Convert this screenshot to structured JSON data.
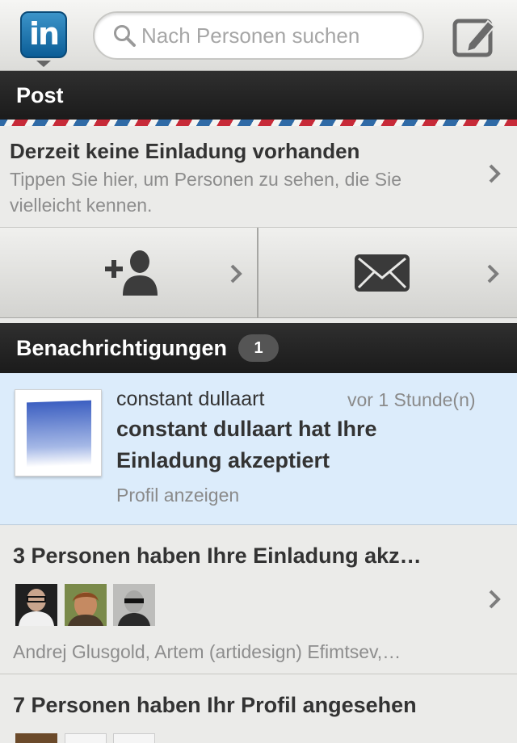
{
  "topbar": {
    "logo_text": "in",
    "search_placeholder": "Nach Personen suchen"
  },
  "inbox": {
    "header": "Post",
    "no_invites_title": "Derzeit keine Einladung vorhanden",
    "no_invites_sub_line1": "Tippen Sie hier, um Personen zu sehen, die Sie",
    "no_invites_sub_line2": "vielleicht kennen."
  },
  "notifications": {
    "header": "Benachrichtigungen",
    "count": "1",
    "items": [
      {
        "name": "constant dullaart",
        "time": "vor 1 Stunde(n)",
        "message_line1": "constant dullaart hat Ihre",
        "message_line2": "Einladung akzeptiert",
        "action": "Profil anzeigen"
      },
      {
        "title": "3 Personen haben Ihre Einladung akz…",
        "names": "Andrej Glusgold, Artem (artidesign) Efimtsev,…"
      },
      {
        "title": "7 Personen haben Ihr Profil angesehen"
      }
    ]
  },
  "colors": {
    "linkedin_blue": "#0b5d97",
    "highlight": "#dcecfb",
    "header_dark": "#1b1b1b"
  }
}
